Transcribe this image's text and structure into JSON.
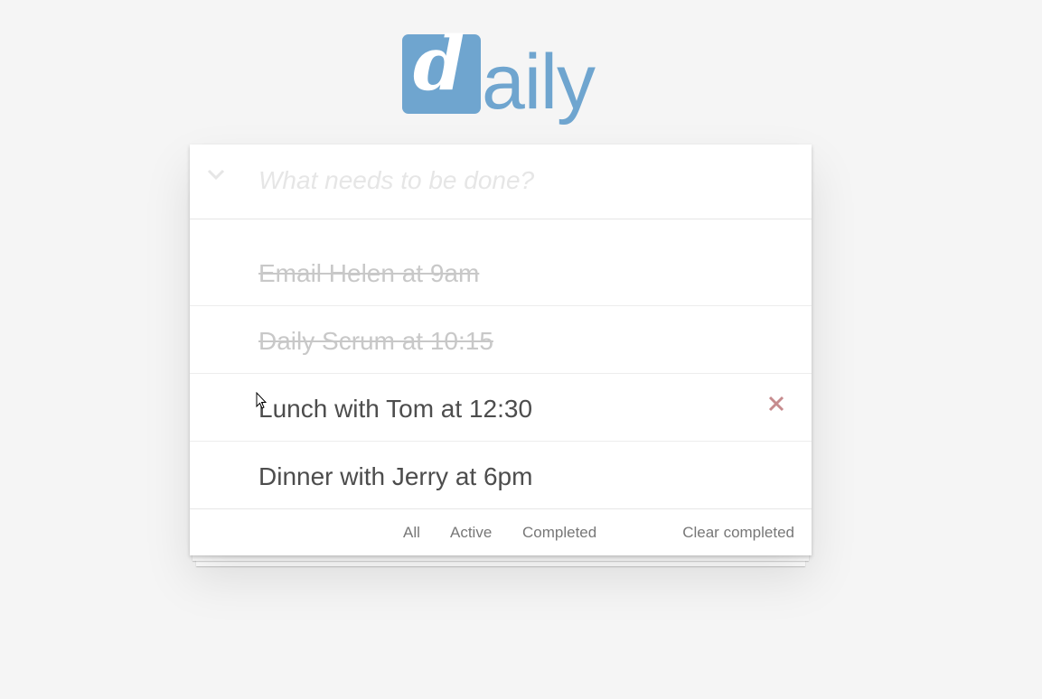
{
  "logo": {
    "letter": "d",
    "rest": "aily",
    "color": "#6fa5cf"
  },
  "new_todo": {
    "placeholder": "What needs to be done?",
    "value": ""
  },
  "todos": [
    {
      "label": "Email Helen at 9am",
      "completed": true
    },
    {
      "label": "Daily Scrum at 10:15",
      "completed": true
    },
    {
      "label": "Lunch with Tom at 12:30",
      "completed": false,
      "hovered": true
    },
    {
      "label": "Dinner with Jerry at 6pm",
      "completed": false
    }
  ],
  "footer": {
    "filters": [
      "All",
      "Active",
      "Completed"
    ],
    "clear_completed": "Clear completed"
  },
  "icons": {
    "toggle_all": "chevron-down-icon",
    "destroy": "close-icon"
  },
  "colors": {
    "background": "#f5f5f5",
    "destroy": "#af5b5e"
  }
}
